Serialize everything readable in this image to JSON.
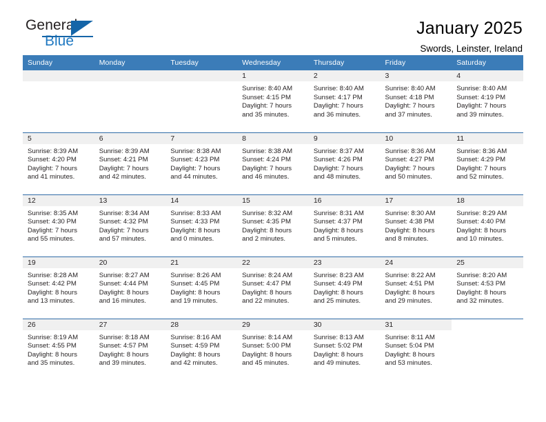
{
  "brand": {
    "name_top": "General",
    "name_bottom": "Blue",
    "accent_color": "#1f78c1"
  },
  "header": {
    "title": "January 2025",
    "subtitle": "Swords, Leinster, Ireland"
  },
  "calendar": {
    "header_background": "#3b7cb8",
    "daynum_background": "#f0f0f0",
    "weekday_headers": [
      "Sunday",
      "Monday",
      "Tuesday",
      "Wednesday",
      "Thursday",
      "Friday",
      "Saturday"
    ],
    "weeks": [
      [
        {
          "day": "",
          "kind": "empty"
        },
        {
          "day": "",
          "kind": "empty"
        },
        {
          "day": "",
          "kind": "empty"
        },
        {
          "day": "1",
          "kind": "day",
          "sunrise": "Sunrise: 8:40 AM",
          "sunset": "Sunset: 4:15 PM",
          "daylight_1": "Daylight: 7 hours",
          "daylight_2": "and 35 minutes."
        },
        {
          "day": "2",
          "kind": "day",
          "sunrise": "Sunrise: 8:40 AM",
          "sunset": "Sunset: 4:17 PM",
          "daylight_1": "Daylight: 7 hours",
          "daylight_2": "and 36 minutes."
        },
        {
          "day": "3",
          "kind": "day",
          "sunrise": "Sunrise: 8:40 AM",
          "sunset": "Sunset: 4:18 PM",
          "daylight_1": "Daylight: 7 hours",
          "daylight_2": "and 37 minutes."
        },
        {
          "day": "4",
          "kind": "day",
          "sunrise": "Sunrise: 8:40 AM",
          "sunset": "Sunset: 4:19 PM",
          "daylight_1": "Daylight: 7 hours",
          "daylight_2": "and 39 minutes."
        }
      ],
      [
        {
          "day": "5",
          "kind": "day",
          "sunrise": "Sunrise: 8:39 AM",
          "sunset": "Sunset: 4:20 PM",
          "daylight_1": "Daylight: 7 hours",
          "daylight_2": "and 41 minutes."
        },
        {
          "day": "6",
          "kind": "day",
          "sunrise": "Sunrise: 8:39 AM",
          "sunset": "Sunset: 4:21 PM",
          "daylight_1": "Daylight: 7 hours",
          "daylight_2": "and 42 minutes."
        },
        {
          "day": "7",
          "kind": "day",
          "sunrise": "Sunrise: 8:38 AM",
          "sunset": "Sunset: 4:23 PM",
          "daylight_1": "Daylight: 7 hours",
          "daylight_2": "and 44 minutes."
        },
        {
          "day": "8",
          "kind": "day",
          "sunrise": "Sunrise: 8:38 AM",
          "sunset": "Sunset: 4:24 PM",
          "daylight_1": "Daylight: 7 hours",
          "daylight_2": "and 46 minutes."
        },
        {
          "day": "9",
          "kind": "day",
          "sunrise": "Sunrise: 8:37 AM",
          "sunset": "Sunset: 4:26 PM",
          "daylight_1": "Daylight: 7 hours",
          "daylight_2": "and 48 minutes."
        },
        {
          "day": "10",
          "kind": "day",
          "sunrise": "Sunrise: 8:36 AM",
          "sunset": "Sunset: 4:27 PM",
          "daylight_1": "Daylight: 7 hours",
          "daylight_2": "and 50 minutes."
        },
        {
          "day": "11",
          "kind": "day",
          "sunrise": "Sunrise: 8:36 AM",
          "sunset": "Sunset: 4:29 PM",
          "daylight_1": "Daylight: 7 hours",
          "daylight_2": "and 52 minutes."
        }
      ],
      [
        {
          "day": "12",
          "kind": "day",
          "sunrise": "Sunrise: 8:35 AM",
          "sunset": "Sunset: 4:30 PM",
          "daylight_1": "Daylight: 7 hours",
          "daylight_2": "and 55 minutes."
        },
        {
          "day": "13",
          "kind": "day",
          "sunrise": "Sunrise: 8:34 AM",
          "sunset": "Sunset: 4:32 PM",
          "daylight_1": "Daylight: 7 hours",
          "daylight_2": "and 57 minutes."
        },
        {
          "day": "14",
          "kind": "day",
          "sunrise": "Sunrise: 8:33 AM",
          "sunset": "Sunset: 4:33 PM",
          "daylight_1": "Daylight: 8 hours",
          "daylight_2": "and 0 minutes."
        },
        {
          "day": "15",
          "kind": "day",
          "sunrise": "Sunrise: 8:32 AM",
          "sunset": "Sunset: 4:35 PM",
          "daylight_1": "Daylight: 8 hours",
          "daylight_2": "and 2 minutes."
        },
        {
          "day": "16",
          "kind": "day",
          "sunrise": "Sunrise: 8:31 AM",
          "sunset": "Sunset: 4:37 PM",
          "daylight_1": "Daylight: 8 hours",
          "daylight_2": "and 5 minutes."
        },
        {
          "day": "17",
          "kind": "day",
          "sunrise": "Sunrise: 8:30 AM",
          "sunset": "Sunset: 4:38 PM",
          "daylight_1": "Daylight: 8 hours",
          "daylight_2": "and 8 minutes."
        },
        {
          "day": "18",
          "kind": "day",
          "sunrise": "Sunrise: 8:29 AM",
          "sunset": "Sunset: 4:40 PM",
          "daylight_1": "Daylight: 8 hours",
          "daylight_2": "and 10 minutes."
        }
      ],
      [
        {
          "day": "19",
          "kind": "day",
          "sunrise": "Sunrise: 8:28 AM",
          "sunset": "Sunset: 4:42 PM",
          "daylight_1": "Daylight: 8 hours",
          "daylight_2": "and 13 minutes."
        },
        {
          "day": "20",
          "kind": "day",
          "sunrise": "Sunrise: 8:27 AM",
          "sunset": "Sunset: 4:44 PM",
          "daylight_1": "Daylight: 8 hours",
          "daylight_2": "and 16 minutes."
        },
        {
          "day": "21",
          "kind": "day",
          "sunrise": "Sunrise: 8:26 AM",
          "sunset": "Sunset: 4:45 PM",
          "daylight_1": "Daylight: 8 hours",
          "daylight_2": "and 19 minutes."
        },
        {
          "day": "22",
          "kind": "day",
          "sunrise": "Sunrise: 8:24 AM",
          "sunset": "Sunset: 4:47 PM",
          "daylight_1": "Daylight: 8 hours",
          "daylight_2": "and 22 minutes."
        },
        {
          "day": "23",
          "kind": "day",
          "sunrise": "Sunrise: 8:23 AM",
          "sunset": "Sunset: 4:49 PM",
          "daylight_1": "Daylight: 8 hours",
          "daylight_2": "and 25 minutes."
        },
        {
          "day": "24",
          "kind": "day",
          "sunrise": "Sunrise: 8:22 AM",
          "sunset": "Sunset: 4:51 PM",
          "daylight_1": "Daylight: 8 hours",
          "daylight_2": "and 29 minutes."
        },
        {
          "day": "25",
          "kind": "day",
          "sunrise": "Sunrise: 8:20 AM",
          "sunset": "Sunset: 4:53 PM",
          "daylight_1": "Daylight: 8 hours",
          "daylight_2": "and 32 minutes."
        }
      ],
      [
        {
          "day": "26",
          "kind": "day",
          "sunrise": "Sunrise: 8:19 AM",
          "sunset": "Sunset: 4:55 PM",
          "daylight_1": "Daylight: 8 hours",
          "daylight_2": "and 35 minutes."
        },
        {
          "day": "27",
          "kind": "day",
          "sunrise": "Sunrise: 8:18 AM",
          "sunset": "Sunset: 4:57 PM",
          "daylight_1": "Daylight: 8 hours",
          "daylight_2": "and 39 minutes."
        },
        {
          "day": "28",
          "kind": "day",
          "sunrise": "Sunrise: 8:16 AM",
          "sunset": "Sunset: 4:59 PM",
          "daylight_1": "Daylight: 8 hours",
          "daylight_2": "and 42 minutes."
        },
        {
          "day": "29",
          "kind": "day",
          "sunrise": "Sunrise: 8:14 AM",
          "sunset": "Sunset: 5:00 PM",
          "daylight_1": "Daylight: 8 hours",
          "daylight_2": "and 45 minutes."
        },
        {
          "day": "30",
          "kind": "day",
          "sunrise": "Sunrise: 8:13 AM",
          "sunset": "Sunset: 5:02 PM",
          "daylight_1": "Daylight: 8 hours",
          "daylight_2": "and 49 minutes."
        },
        {
          "day": "31",
          "kind": "day",
          "sunrise": "Sunrise: 8:11 AM",
          "sunset": "Sunset: 5:04 PM",
          "daylight_1": "Daylight: 8 hours",
          "daylight_2": "and 53 minutes."
        },
        {
          "day": "",
          "kind": "blank"
        }
      ]
    ]
  }
}
